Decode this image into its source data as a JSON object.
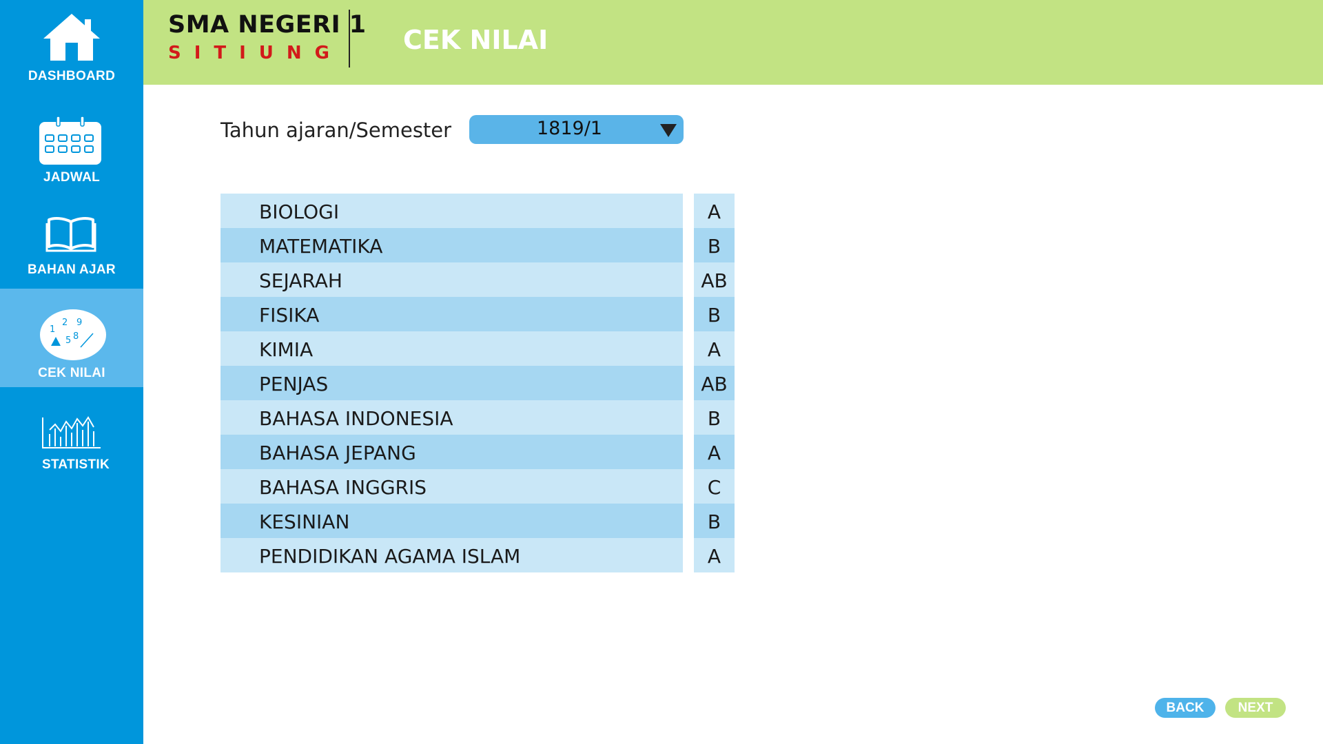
{
  "sidebar": {
    "items": [
      {
        "label": "DASHBOARD",
        "icon": "home-icon"
      },
      {
        "label": "JADWAL",
        "icon": "calendar-icon"
      },
      {
        "label": "BAHAN AJAR",
        "icon": "book-icon"
      },
      {
        "label": "CEK NILAI",
        "icon": "numbers-icon",
        "active": true
      },
      {
        "label": "STATISTIK",
        "icon": "bar-chart-icon"
      }
    ]
  },
  "header": {
    "school_name": "SMA NEGERI 1",
    "school_city": "SITIUNG",
    "page_title": "CEK NILAI"
  },
  "semester": {
    "label": "Tahun ajaran/Semester",
    "value": "1819/1"
  },
  "grades": [
    {
      "subject": "BIOLOGI",
      "grade": "A"
    },
    {
      "subject": "MATEMATIKA",
      "grade": "B"
    },
    {
      "subject": "SEJARAH",
      "grade": "AB"
    },
    {
      "subject": "FISIKA",
      "grade": "B"
    },
    {
      "subject": "KIMIA",
      "grade": "A"
    },
    {
      "subject": "PENJAS",
      "grade": "AB"
    },
    {
      "subject": "BAHASA INDONESIA",
      "grade": "B"
    },
    {
      "subject": "BAHASA JEPANG",
      "grade": "A"
    },
    {
      "subject": "BAHASA INGGRIS",
      "grade": "C"
    },
    {
      "subject": "KESINIAN",
      "grade": "B"
    },
    {
      "subject": "PENDIDIKAN AGAMA ISLAM",
      "grade": "A"
    }
  ],
  "footer": {
    "back_label": "BACK",
    "next_label": "NEXT"
  },
  "colors": {
    "sidebar": "#0096dc",
    "sidebar_active": "#5bb8ec",
    "header": "#c2e383",
    "city_red": "#d21a1a",
    "row_light": "#c9e7f7",
    "row_dark": "#a6d7f2",
    "back_button": "#4eb3ea",
    "next_button": "#c2e383"
  }
}
